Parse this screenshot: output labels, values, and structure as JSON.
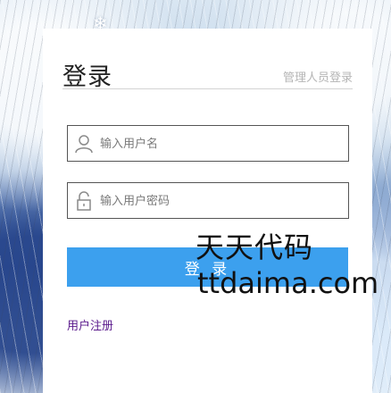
{
  "background": {
    "decoration_icon": "snowflake-icon",
    "snowflake_glyph": "❄"
  },
  "login_panel": {
    "title": "登录",
    "admin_login_link": "管理人员登录",
    "username_field": {
      "placeholder": "输入用户名",
      "value": "",
      "icon": "user-icon"
    },
    "password_field": {
      "placeholder": "输入用户密码",
      "value": "",
      "icon": "lock-icon"
    },
    "login_button_label": "登 录",
    "register_link": "用户注册",
    "accent_color": "#3ca0ee"
  },
  "watermark": {
    "chinese_text": "天天代码",
    "domain_text": "ttdaima.com"
  }
}
